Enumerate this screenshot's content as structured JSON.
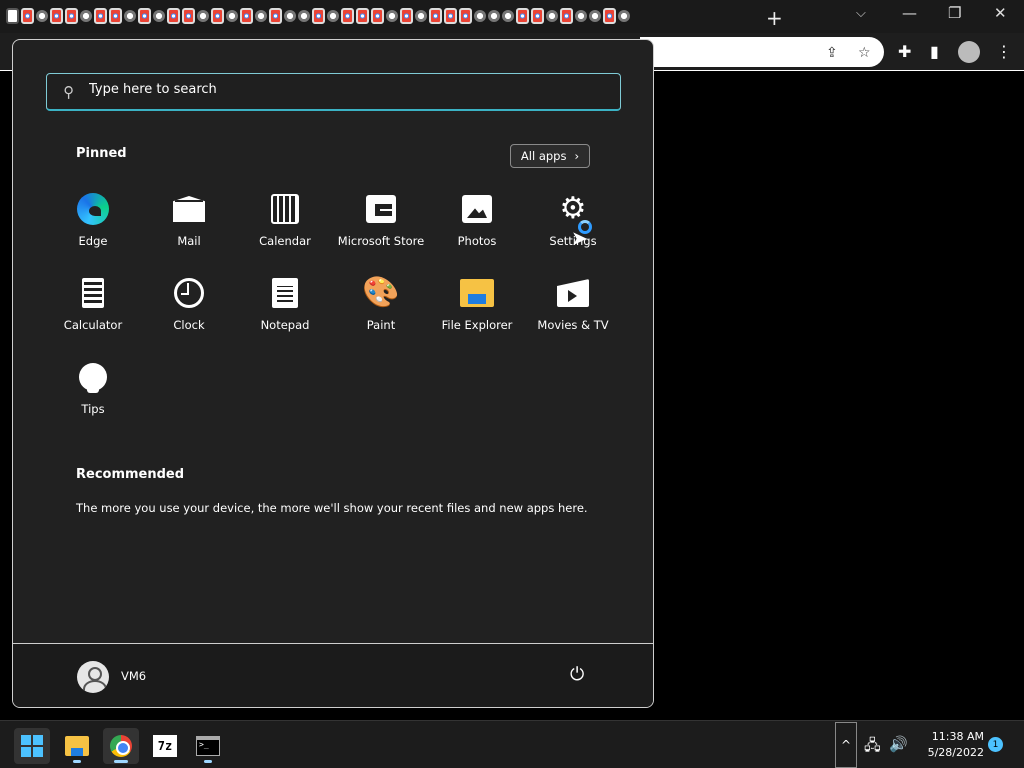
{
  "browser": {
    "newtab_glyph": "+",
    "tab_search_glyph": "⌵",
    "win_minimize": "—",
    "win_restore": "❐",
    "win_close": "✕",
    "omnibox_share_glyph": "⇪",
    "omnibox_star_glyph": "☆",
    "toolbar_extensions_glyph": "✚",
    "toolbar_sidepanel_glyph": "▮",
    "toolbar_menu_glyph": "⋮"
  },
  "start_menu": {
    "search": {
      "placeholder": "Type here to search"
    },
    "pinned": {
      "title": "Pinned",
      "all_apps_label": "All apps",
      "all_apps_chevron": "›",
      "apps": [
        {
          "label": "Edge",
          "icon": "edge-icon"
        },
        {
          "label": "Mail",
          "icon": "mail-icon"
        },
        {
          "label": "Calendar",
          "icon": "calendar-icon"
        },
        {
          "label": "Microsoft Store",
          "icon": "store-icon"
        },
        {
          "label": "Photos",
          "icon": "photos-icon"
        },
        {
          "label": "Settings",
          "icon": "gear-icon"
        },
        {
          "label": "Calculator",
          "icon": "calculator-icon"
        },
        {
          "label": "Clock",
          "icon": "clock-icon"
        },
        {
          "label": "Notepad",
          "icon": "notepad-icon"
        },
        {
          "label": "Paint",
          "icon": "paint-icon"
        },
        {
          "label": "File Explorer",
          "icon": "folder-icon"
        },
        {
          "label": "Movies & TV",
          "icon": "movies-icon"
        },
        {
          "label": "Tips",
          "icon": "lightbulb-icon"
        }
      ]
    },
    "recommended": {
      "title": "Recommended",
      "empty_text": "The more you use your device, the more we'll show your recent files and new apps here."
    },
    "footer": {
      "user_name": "VM6",
      "power_glyph": "⏻"
    }
  },
  "taskbar": {
    "apps": [
      {
        "name": "start",
        "icon": "windows-logo-icon"
      },
      {
        "name": "file-explorer",
        "icon": "folder-icon"
      },
      {
        "name": "chrome",
        "icon": "chrome-icon"
      },
      {
        "name": "7zip",
        "icon": "7zip-icon",
        "text": "7z"
      },
      {
        "name": "terminal",
        "icon": "terminal-icon"
      }
    ],
    "tray": {
      "overflow_glyph": "^",
      "network_glyph": "🖧",
      "volume_glyph": "🔊",
      "time": "11:38 AM",
      "date": "5/28/2022",
      "notification_count": "1"
    }
  },
  "colors": {
    "accent": "#4cc2ff",
    "search_border": "#3bb2c4",
    "menu_bg": "#212121"
  }
}
